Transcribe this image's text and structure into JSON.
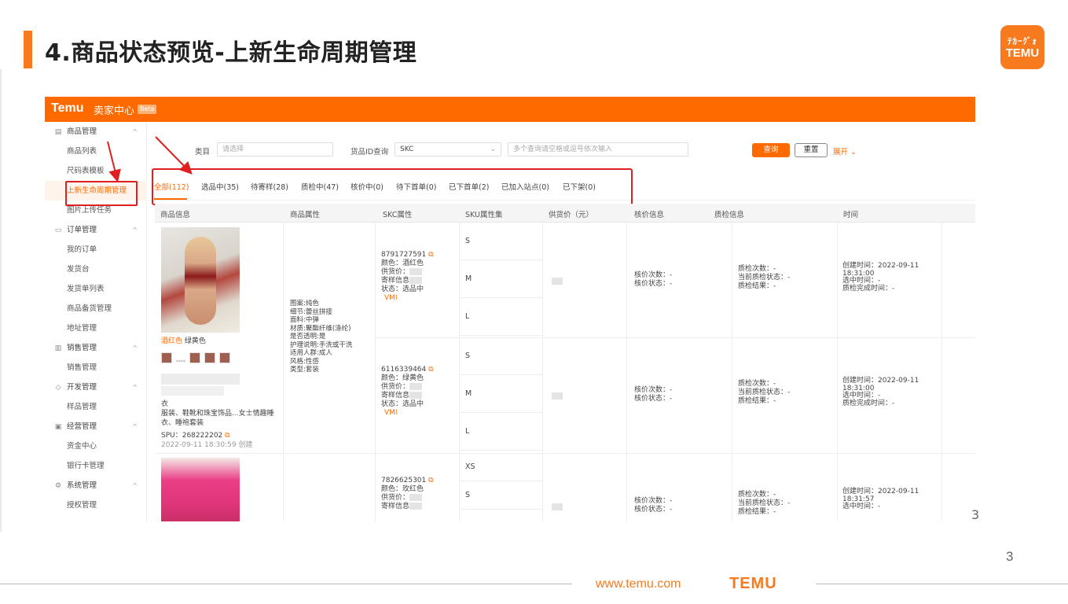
{
  "slide": {
    "title": "4.商品状态预览-上新生命周期管理",
    "logo_top_line": "ﾃｶｰｸﾞｫ",
    "logo_bottom_line": "TEMU",
    "page_number": "3",
    "footer_url": "www.temu.com",
    "footer_logo": "TEMU",
    "edge_char": "3"
  },
  "app": {
    "brand": "Temu",
    "center_label": "卖家中心",
    "beta": "Beta",
    "accent_color": "#ff6a00",
    "highlight_color": "#e02020"
  },
  "sidebar": {
    "groups": [
      {
        "label": "商品管理",
        "icon": "product-icon",
        "items": [
          "商品列表",
          "尺码表模板",
          "上新生命周期管理",
          "图片上传任务"
        ]
      },
      {
        "label": "订单管理",
        "icon": "order-icon",
        "items": [
          "我的订单",
          "发货台",
          "发货单列表",
          "商品备货管理",
          "地址管理"
        ]
      },
      {
        "label": "销售管理",
        "icon": "sales-icon",
        "items": [
          "销售管理"
        ]
      },
      {
        "label": "开发管理",
        "icon": "develop-icon",
        "items": [
          "样品管理"
        ]
      },
      {
        "label": "经营管理",
        "icon": "finance-icon",
        "items": [
          "资金中心",
          "银行卡管理"
        ]
      },
      {
        "label": "系统管理",
        "icon": "system-icon",
        "items": [
          "授权管理"
        ]
      }
    ],
    "active_item": "上新生命周期管理"
  },
  "filter": {
    "category_label": "类目",
    "category_placeholder": "请选择",
    "id_query_label": "货品ID查询",
    "id_type_value": "SKC",
    "id_input_placeholder": "多个查询请空格或逗号依次输入",
    "query_button": "查询",
    "reset_button": "重置",
    "expand_link": "展开"
  },
  "tabs": [
    "全部(112)",
    "选品中(35)",
    "待寄样(28)",
    "质检中(47)",
    "核价中(0)",
    "待下首单(0)",
    "已下首单(2)",
    "已加入站点(0)",
    "已下架(0)"
  ],
  "table": {
    "headers": [
      "商品信息",
      "商品属性",
      "SKC属性",
      "SKU属性集",
      "供货价（元）",
      "核价信息",
      "质检信息",
      "时间"
    ],
    "attributes": [
      "图案:纯色",
      "细节:蕾丝拼接",
      "面料:中弹",
      "材质:聚酯纤维(涤纶)",
      "是否透明:是",
      "护理说明:手洗或干洗",
      "适用人群:成人",
      "风格:性感",
      "类型:套装"
    ],
    "product": {
      "colors": "酒红色  绿黄色",
      "colors_active": "酒红色",
      "colors_rest": "绿黄色",
      "thumb_extra": "****",
      "title_line1": "衣",
      "title_line2": "服装、鞋靴和珠宝饰品...女士情趣睡",
      "title_line3": "衣、睡袍套装",
      "spu_label": "SPU：",
      "spu": "268222202",
      "created": "2022-09-11 18:30:59 创建"
    },
    "skc_rows": [
      {
        "id": "8791727591",
        "color": "颜色：酒红色",
        "price": "供货价：",
        "sample": "寄样信息",
        "status": "状态：选品中",
        "tag": "VMI",
        "sizes": [
          "S",
          "M",
          "L"
        ],
        "price_check": [
          "核价次数：-",
          "核价状态：-"
        ],
        "qc": [
          "质检次数：-",
          "当前质检状态：-",
          "质检结果：-"
        ],
        "time": [
          "创建时间：2022-09-11",
          "18:31:00",
          "选中时间：-",
          "质检完成时间：-"
        ]
      },
      {
        "id": "6116339464",
        "color": "颜色：绿黄色",
        "price": "供货价：",
        "sample": "寄样信息",
        "status": "状态：选品中",
        "tag": "VMI",
        "sizes": [
          "S",
          "M",
          "L"
        ],
        "price_check": [
          "核价次数：-",
          "核价状态：-"
        ],
        "qc": [
          "质检次数：-",
          "当前质检状态：-",
          "质检结果：-"
        ],
        "time": [
          "创建时间：2022-09-11",
          "18:31:00",
          "选中时间：-",
          "质检完成时间：-"
        ]
      },
      {
        "id": "7826625301",
        "color": "颜色：玫红色",
        "price": "供货价：",
        "sample": "寄样信息",
        "sizes": [
          "XS",
          "S"
        ],
        "price_check": [
          "核价次数：-",
          "核价状态：-"
        ],
        "qc": [
          "质检次数：-",
          "当前质检状态：-",
          "质检结果：-"
        ],
        "time": [
          "创建时间：2022-09-11",
          "18:31:57",
          "选中时间：-"
        ]
      }
    ]
  }
}
